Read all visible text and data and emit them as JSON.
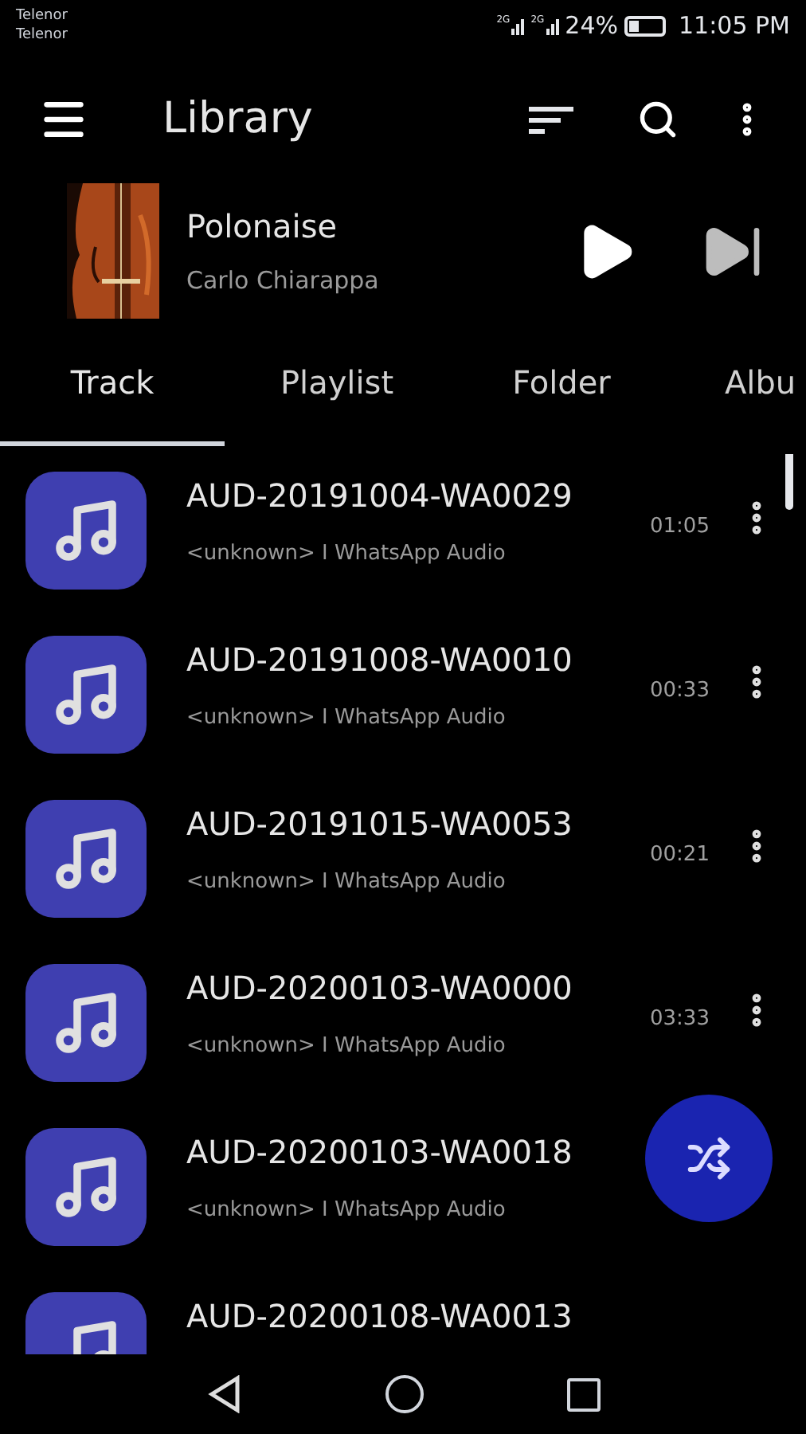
{
  "status_bar": {
    "carriers": [
      "Telenor",
      "Telenor"
    ],
    "network_1": "2G",
    "network_2": "2G",
    "battery": "24%",
    "time": "11:05 PM"
  },
  "app_bar": {
    "title": "Library"
  },
  "now_playing": {
    "title": "Polonaise",
    "artist": "Carlo Chiarappa",
    "playing": false
  },
  "tabs": [
    {
      "label": "Track",
      "selected": true
    },
    {
      "label": "Playlist",
      "selected": false
    },
    {
      "label": "Folder",
      "selected": false
    },
    {
      "label": "Albu",
      "selected": false
    }
  ],
  "tracks": [
    {
      "title": "AUD-20191004-WA0029",
      "subtitle": "<unknown> I WhatsApp Audio",
      "duration": "01:05"
    },
    {
      "title": "AUD-20191008-WA0010",
      "subtitle": "<unknown> I WhatsApp Audio",
      "duration": "00:33"
    },
    {
      "title": "AUD-20191015-WA0053",
      "subtitle": "<unknown> I WhatsApp Audio",
      "duration": "00:21"
    },
    {
      "title": "AUD-20200103-WA0000",
      "subtitle": "<unknown> I WhatsApp Audio",
      "duration": "03:33"
    },
    {
      "title": "AUD-20200103-WA0018",
      "subtitle": "<unknown> I WhatsApp Audio"
    },
    {
      "title": "AUD-20200108-WA0013"
    }
  ]
}
